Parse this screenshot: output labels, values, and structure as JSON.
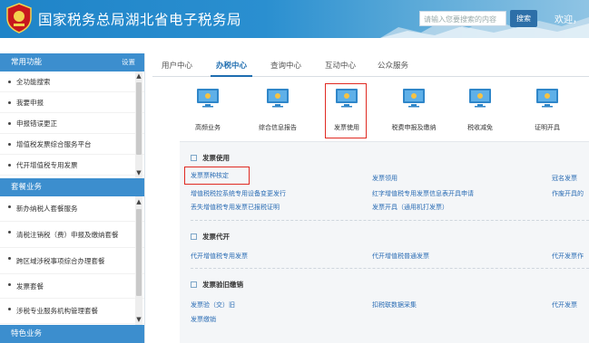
{
  "header": {
    "title": "国家税务总局湖北省电子税务局",
    "search_placeholder": "请输入您要搜索的内容",
    "search_button": "搜索",
    "welcome": "欢迎，"
  },
  "sidebar": {
    "sections": [
      {
        "title": "常用功能",
        "action": "设置",
        "items": [
          "全功能搜索",
          "我要申报",
          "申报错误更正",
          "增值税发票综合服务平台",
          "代开增值税专用发票"
        ]
      },
      {
        "title": "套餐业务",
        "items": [
          "新办纳税人套餐服务",
          "清税注销税（费）申报及缴纳套餐",
          "跨区域涉税事项综合办理套餐",
          "发票套餐",
          "涉税专业服务机构管理套餐"
        ]
      },
      {
        "title": "特色业务",
        "items": []
      }
    ]
  },
  "tabs": [
    "用户中心",
    "办税中心",
    "查询中心",
    "互动中心",
    "公众服务"
  ],
  "active_tab": "办税中心",
  "icons": [
    "高频业务",
    "综合信息报告",
    "发票使用",
    "税费申报及缴纳",
    "税收减免",
    "证明开具"
  ],
  "panel": {
    "sections": [
      {
        "title": "发票使用",
        "col1": [
          "发票票种核定",
          "增值税税控系统专用设备变更发行",
          "丢失增值税专用发票已报税证明"
        ],
        "col2": [
          "发票领用",
          "红字增值税专用发票信息表开具申请",
          "发票开具（通用机打发票）"
        ],
        "col3": [
          "冠名发票",
          "作废开具的"
        ]
      },
      {
        "title": "发票代开",
        "col1": [
          "代开增值税专用发票"
        ],
        "col2": [
          "代开增值税普通发票"
        ],
        "col3": [
          "代开发票作"
        ]
      },
      {
        "title": "发票验旧缴销",
        "col1": [
          "发票验（交）旧",
          "发票缴销"
        ],
        "col2": [
          "扣税联数据采集"
        ],
        "col3": [
          "代开发票"
        ]
      }
    ]
  },
  "colors": {
    "header_blue": "#2a8fd0",
    "section_blue": "#3c8ece",
    "link_blue": "#2a6cb4",
    "highlight_red": "#e02a22"
  }
}
